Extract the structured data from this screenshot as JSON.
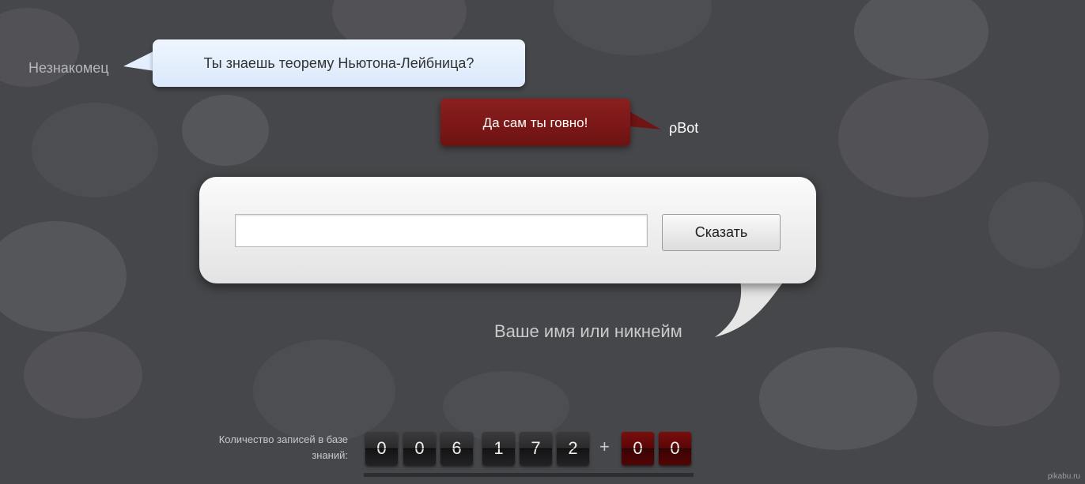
{
  "chat": {
    "stranger_name": "Незнакомец",
    "stranger_message": "Ты знаешь теорему Ньютона-Лейбница?",
    "bot_name": "ρBot",
    "bot_message": "Да сам ты говно!"
  },
  "form": {
    "input_value": "",
    "button_label": "Сказать",
    "name_placeholder": "Ваше имя или никнейм"
  },
  "counter": {
    "label": "Количество записей в базе знаний:",
    "digits": [
      "0",
      "0",
      "6",
      "1",
      "7",
      "2"
    ],
    "plus": "+",
    "new_digits": [
      "0",
      "0"
    ]
  },
  "watermark": "pikabu.ru",
  "colors": {
    "background": "#46474a",
    "stranger_bubble": "#e3eefc",
    "bot_bubble": "#7a1818",
    "panel": "#f0f0f0",
    "counter_red": "#6a0a0a"
  },
  "icons": [
    "speech-bubble-tail"
  ]
}
